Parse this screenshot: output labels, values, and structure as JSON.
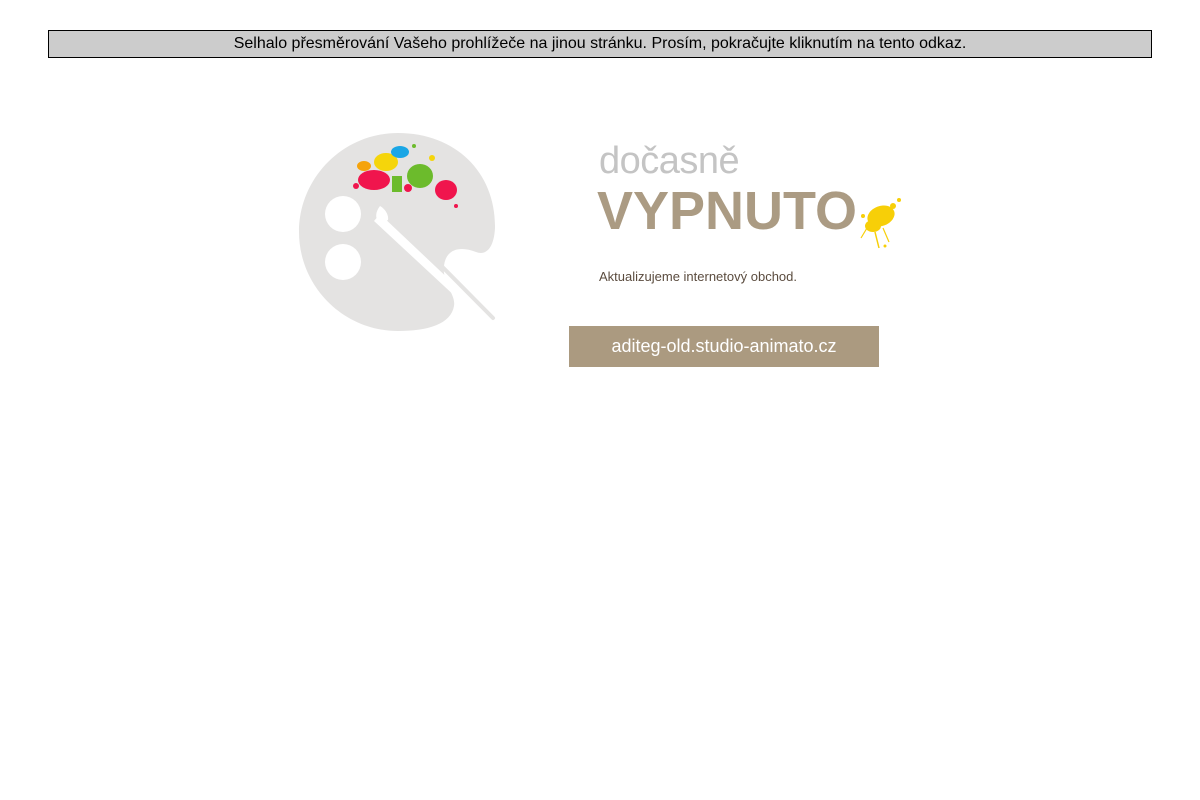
{
  "redirect_notice": {
    "text": "Selhalo přesměrování Vašeho prohlížeče na jinou stránku. Prosím, pokračujte kliknutím na tento odkaz."
  },
  "hero": {
    "title_small": "dočasně",
    "title_big": "VYPNUTO",
    "description": "Aktualizujeme internetový obchod.",
    "url": "aditeg-old.studio-animato.cz"
  },
  "icons": {
    "palette": "paint-palette-icon",
    "splash": "paint-splash-icon"
  },
  "colors": {
    "accent": "#ab9a80",
    "palette_gray": "#e4e3e2",
    "notice_bg": "#cccccc",
    "text_dark": "#5b4c3f"
  }
}
